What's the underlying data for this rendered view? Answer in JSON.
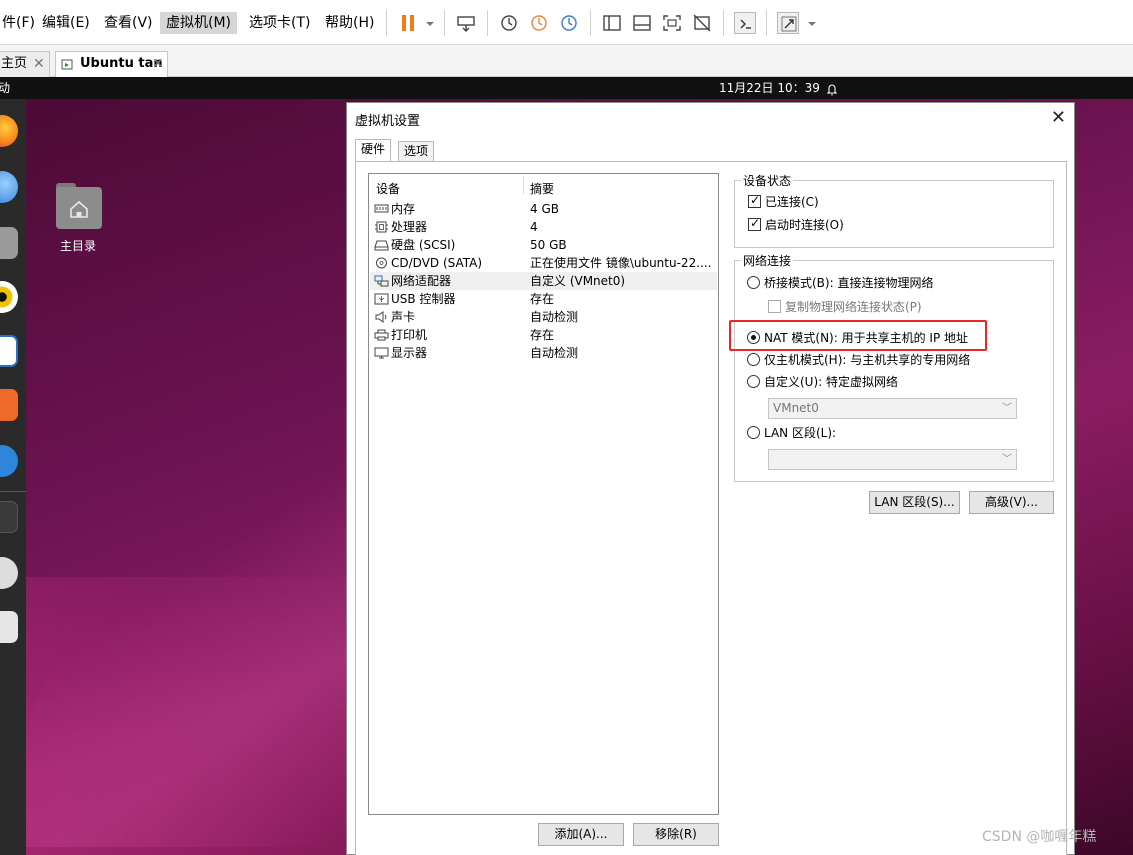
{
  "menubar": {
    "items": [
      {
        "label": "件(F)"
      },
      {
        "label": "编辑(E)"
      },
      {
        "label": "查看(V)"
      },
      {
        "label": "虚拟机(M)",
        "active": true
      },
      {
        "label": "选项卡(T)"
      },
      {
        "label": "帮助(H)"
      }
    ]
  },
  "tabs": [
    {
      "label": "主页"
    },
    {
      "label": "Ubuntu tan",
      "selected": true
    }
  ],
  "guest": {
    "topbar_left": "动",
    "clock": "11月22日  10：39",
    "home_folder_label": "主目录"
  },
  "dialog": {
    "title": "虚拟机设置",
    "tabs": [
      "硬件",
      "选项"
    ],
    "list_headers": {
      "device": "设备",
      "summary": "摘要"
    },
    "devices": [
      {
        "name": "内存",
        "summary": "4 GB",
        "icon": "memory-icon"
      },
      {
        "name": "处理器",
        "summary": "4",
        "icon": "cpu-icon"
      },
      {
        "name": "硬盘 (SCSI)",
        "summary": "50 GB",
        "icon": "hard-disk-icon"
      },
      {
        "name": "CD/DVD (SATA)",
        "summary": "正在使用文件 镜像\\ubuntu-22....",
        "icon": "cd-dvd-icon"
      },
      {
        "name": "网络适配器",
        "summary": "自定义 (VMnet0)",
        "icon": "network-adapter-icon",
        "selected": true
      },
      {
        "name": "USB 控制器",
        "summary": "存在",
        "icon": "usb-icon"
      },
      {
        "name": "声卡",
        "summary": "自动检测",
        "icon": "speaker-icon"
      },
      {
        "name": "打印机",
        "summary": "存在",
        "icon": "printer-icon"
      },
      {
        "name": "显示器",
        "summary": "自动检测",
        "icon": "monitor-icon"
      }
    ],
    "add_button": "添加(A)...",
    "remove_button": "移除(R)",
    "device_status": {
      "legend": "设备状态",
      "connected": "已连接(C)",
      "connect_at_power_on": "启动时连接(O)"
    },
    "network": {
      "legend": "网络连接",
      "bridged": "桥接模式(B): 直接连接物理网络",
      "replicate_state": "复制物理网络连接状态(P)",
      "nat": "NAT 模式(N): 用于共享主机的 IP 地址",
      "host_only": "仅主机模式(H): 与主机共享的专用网络",
      "custom": "自定义(U): 特定虚拟网络",
      "custom_select_value": "VMnet0",
      "lan_segment": "LAN 区段(L):",
      "lan_select_value": "",
      "selected_mode": "nat"
    },
    "lan_segments_button": "LAN 区段(S)...",
    "advanced_button": "高级(V)..."
  },
  "watermark": "CSDN @咖喱年糕",
  "colors": {
    "highlight": "#e5272b",
    "ubuntu_bg": "#6a1250",
    "pause_orange": "#f07d1a"
  }
}
